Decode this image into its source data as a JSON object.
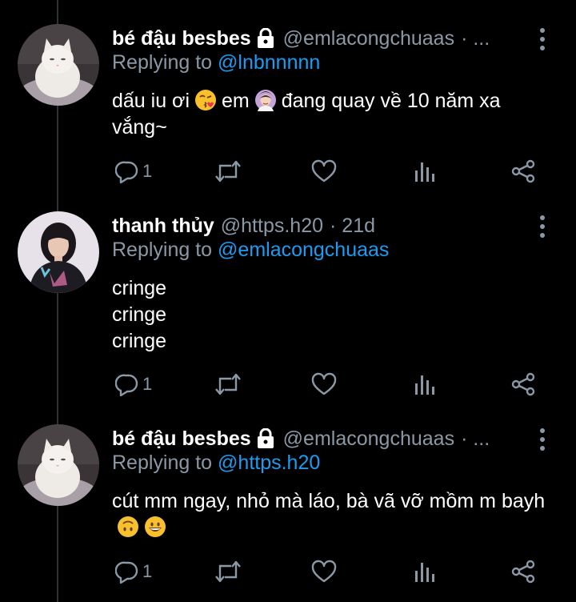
{
  "tweets": [
    {
      "name": "bé đậu besbes",
      "handle": "@emlacongchuaas",
      "meta": "· ...",
      "replying_prefix": "Replying to",
      "replying_to": "@lnbnnnnn",
      "text_parts": [
        "dấu iu ơi",
        "em",
        "đang quay về 10 năm xa vắng~"
      ],
      "emojis": [
        "face-blowing-kiss-emoji",
        "person-gesturing-ok-emoji"
      ],
      "reply_count": "1"
    },
    {
      "name": "thanh thủy",
      "handle": "@https.h20",
      "meta": "· 21d",
      "replying_prefix": "Replying to",
      "replying_to": "@emlacongchuaas",
      "lines": [
        "cringe",
        "cringe",
        "cringe"
      ],
      "reply_count": "1"
    },
    {
      "name": "bé đậu besbes",
      "handle": "@emlacongchuaas",
      "meta": "· ...",
      "replying_prefix": "Replying to",
      "replying_to": "@https.h20",
      "text_parts": [
        "cút mm ngay, nhỏ mà láo, bà vã vỡ mồm m bayh"
      ],
      "emojis": [
        "upside-down-face-emoji",
        "grinning-face-emoji"
      ],
      "reply_count": "1"
    }
  ],
  "colors": {
    "background": "#000000",
    "text": "#ffffff",
    "secondary": "#8b98a5",
    "accent": "#1d9bf0",
    "icon": "#8b98a5",
    "thread_line": "#2f3336"
  },
  "icons": [
    "lock-icon",
    "more-vertical-icon",
    "reply-icon",
    "retweet-icon",
    "like-icon",
    "analytics-icon",
    "share-icon"
  ]
}
